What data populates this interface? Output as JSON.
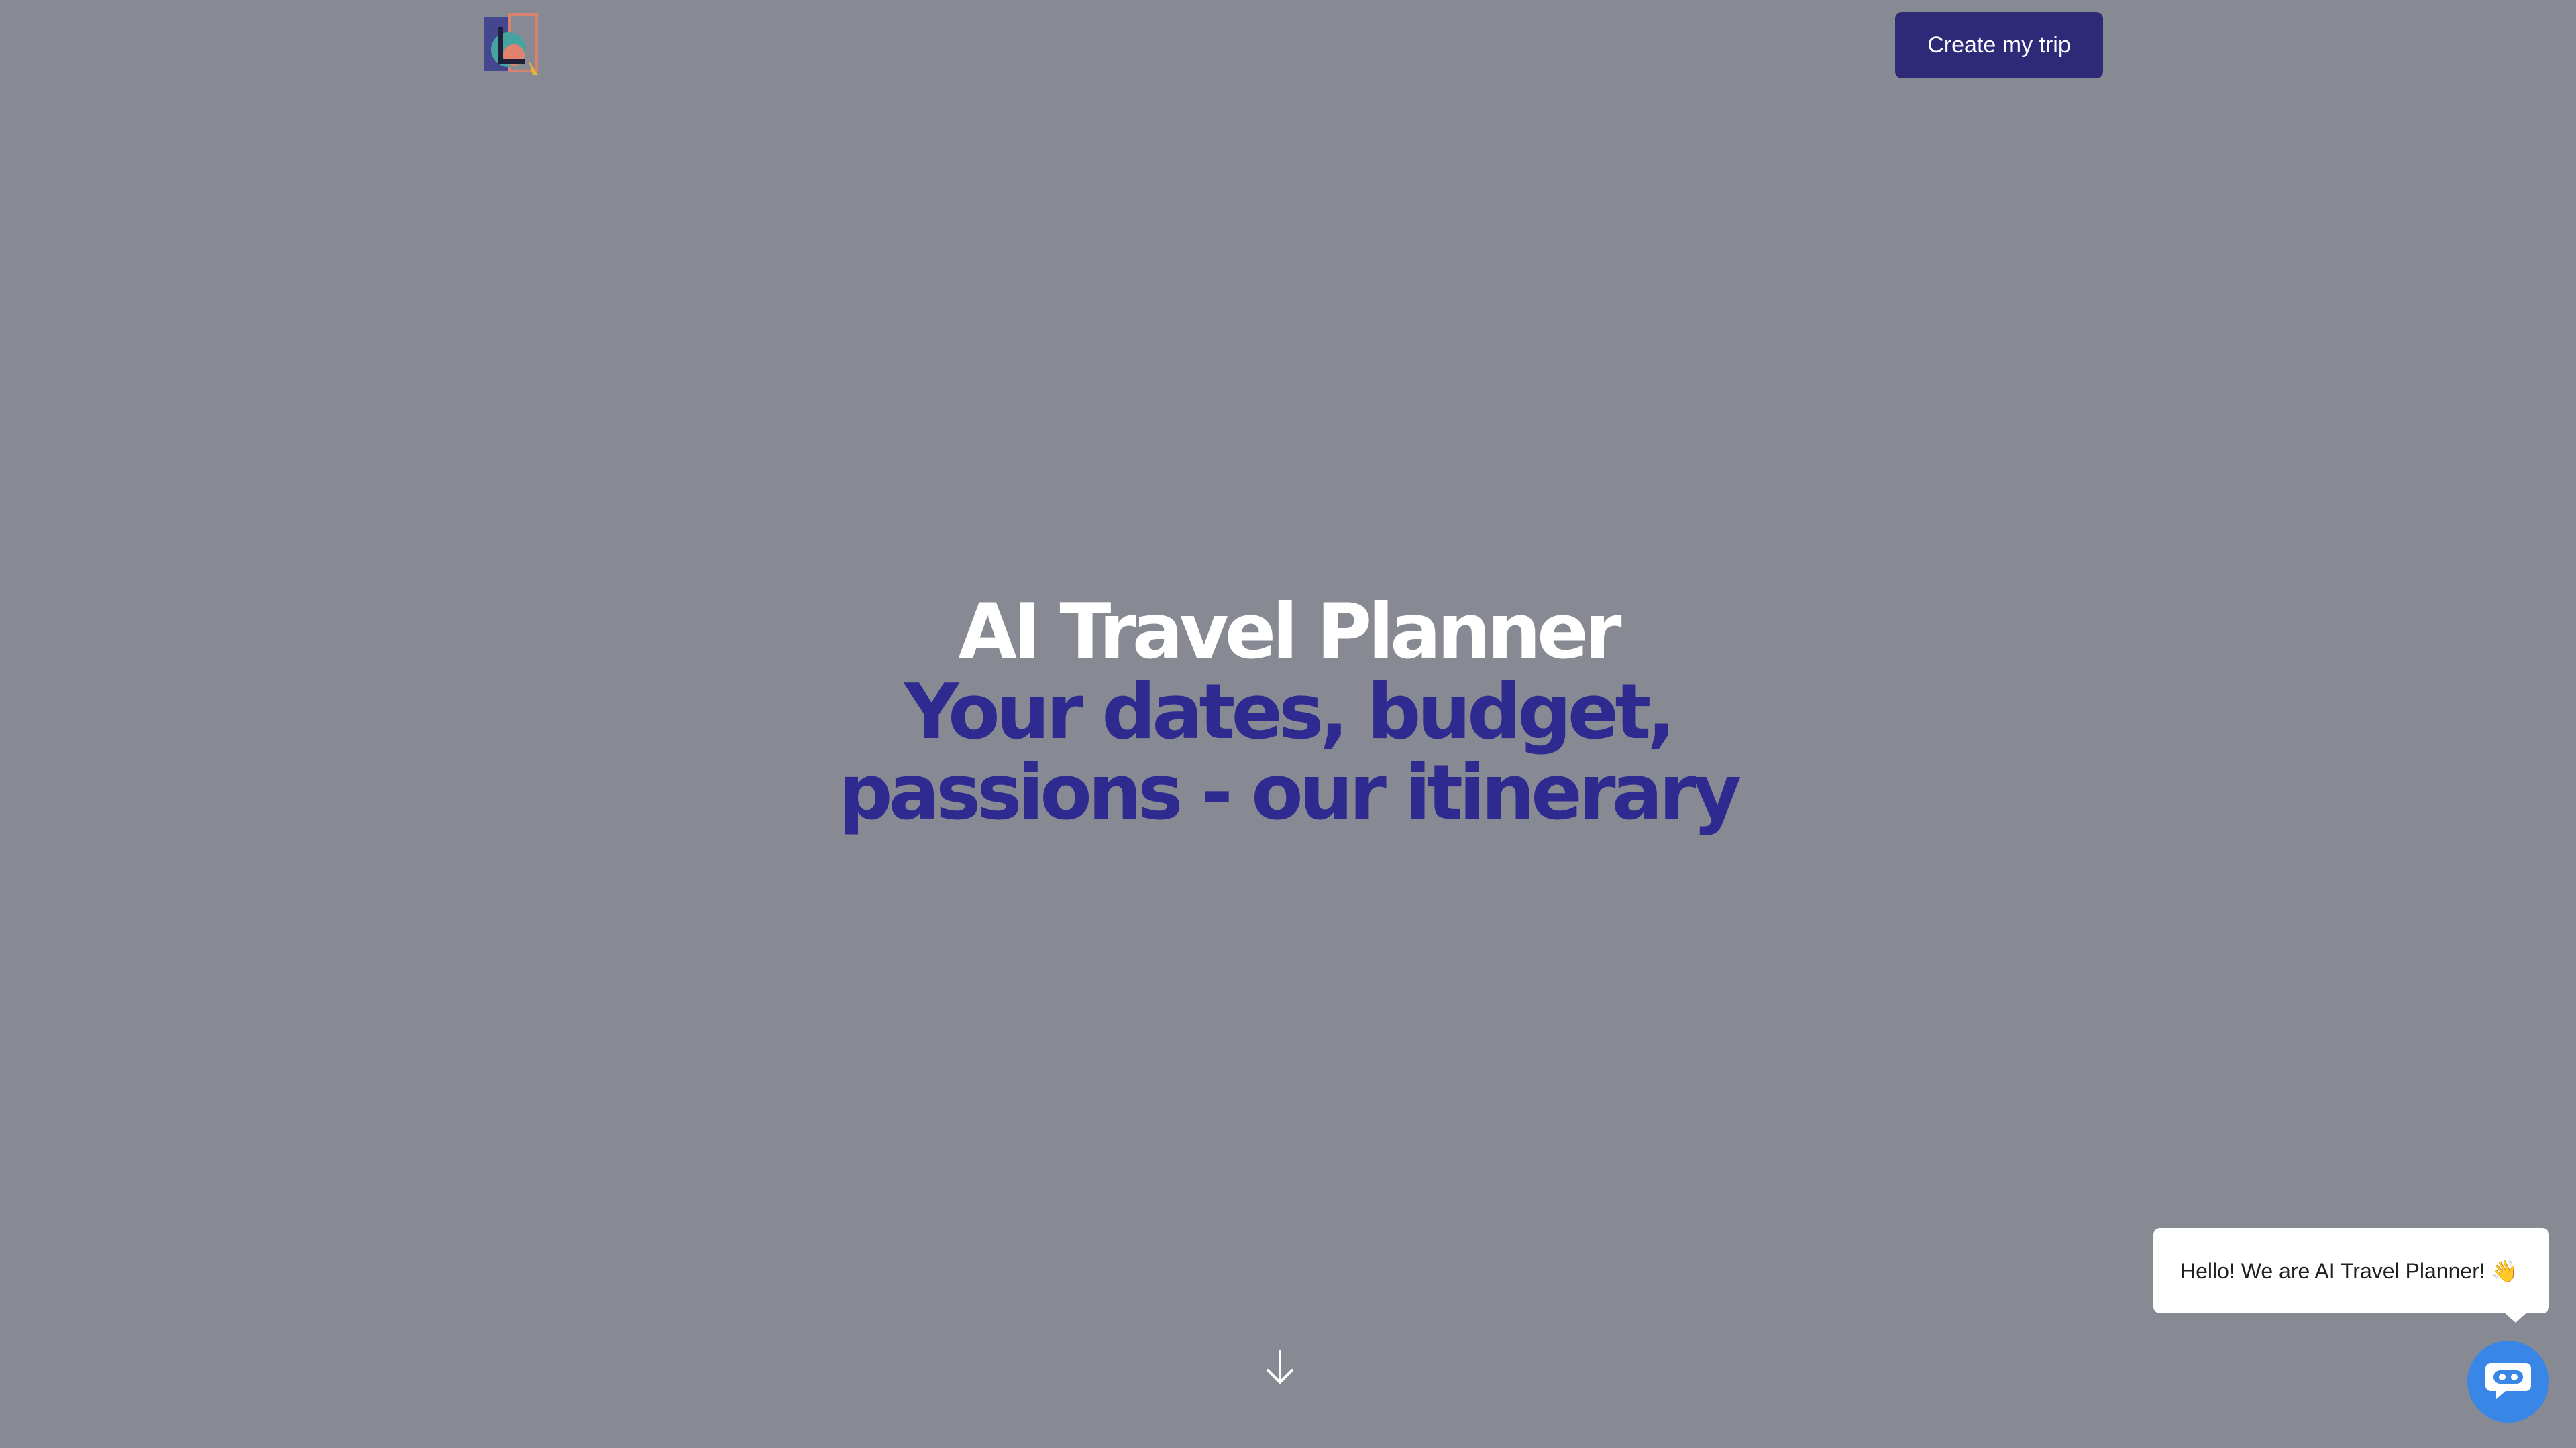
{
  "header": {
    "logo_icon": "app-logo-icon",
    "cta_label": "Create my trip"
  },
  "hero": {
    "title": "AI Travel Planner",
    "subtitle_line1": "Your dates, budget,",
    "subtitle_line2": "passions - our itinerary",
    "scroll_icon": "arrow-down-icon"
  },
  "chat": {
    "greeting": "Hello! We are AI Travel Planner! 👋",
    "launcher_icon": "chatbot-icon"
  },
  "colors": {
    "background": "#878a93",
    "accent": "#2e2a78",
    "subtitle": "#2f2a8f",
    "chat_button": "#3a86e6"
  }
}
